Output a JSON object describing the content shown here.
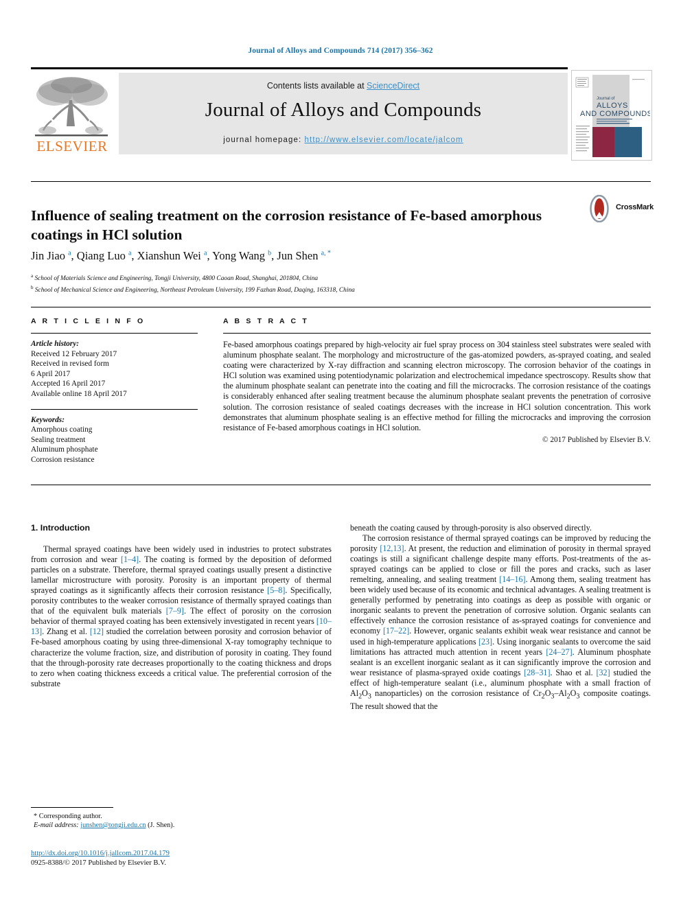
{
  "running_head": "Journal of Alloys and Compounds 714 (2017) 356–362",
  "masthead": {
    "contents_prefix": "Contents lists available at ",
    "sciencedirect": "ScienceDirect",
    "journal_title": "Journal of Alloys and Compounds",
    "homepage_prefix": "journal homepage: ",
    "homepage_url": "http://www.elsevier.com/locate/jalcom",
    "publisher": "ELSEVIER",
    "cover": {
      "line1": "Journal of",
      "line2": "ALLOYS",
      "line3": "AND COMPOUNDS"
    },
    "accent_link_color": "#3a8fc8",
    "elsevier_orange": "#E87722"
  },
  "crossmark": {
    "label": "CrossMark"
  },
  "article": {
    "title": "Influence of sealing treatment on the corrosion resistance of Fe-based amorphous coatings in HCl solution",
    "authors_html": "Jin Jiao <sup>a</sup>, Qiang Luo <sup>a</sup>, Xianshun Wei <sup>a</sup>, Yong Wang <sup>b</sup>, Jun Shen <sup>a, *</sup>",
    "affiliation_a": "School of Materials Science and Engineering, Tongji University, 4800 Caoan Road, Shanghai, 201804, China",
    "affiliation_b": "School of Mechanical Science and Engineering, Northeast Petroleum University, 199 Fazhan Road, Daqing, 163318, China"
  },
  "info": {
    "heading": "A R T I C L E   I N F O",
    "history_label": "Article history:",
    "history": [
      "Received 12 February 2017",
      "Received in revised form",
      "6 April 2017",
      "Accepted 16 April 2017",
      "Available online 18 April 2017"
    ],
    "keywords_label": "Keywords:",
    "keywords": [
      "Amorphous coating",
      "Sealing treatment",
      "Aluminum phosphate",
      "Corrosion resistance"
    ]
  },
  "abstract": {
    "heading": "A B S T R A C T",
    "text": "Fe-based amorphous coatings prepared by high-velocity air fuel spray process on 304 stainless steel substrates were sealed with aluminum phosphate sealant. The morphology and microstructure of the gas-atomized powders, as-sprayed coating, and sealed coating were characterized by X-ray diffraction and scanning electron microscopy. The corrosion behavior of the coatings in HCl solution was examined using potentiodynamic polarization and electrochemical impedance spectroscopy. Results show that the aluminum phosphate sealant can penetrate into the coating and fill the microcracks. The corrosion resistance of the coatings is considerably enhanced after sealing treatment because the aluminum phosphate sealant prevents the penetration of corrosive solution. The corrosion resistance of sealed coatings decreases with the increase in HCl solution concentration. This work demonstrates that aluminum phosphate sealing is an effective method for filling the microcracks and improving the corrosion resistance of Fe-based amorphous coatings in HCl solution.",
    "copyright": "© 2017 Published by Elsevier B.V."
  },
  "body": {
    "section_title": "1. Introduction",
    "left_paragraphs_html": [
      "Thermal sprayed coatings have been widely used in industries to protect substrates from corrosion and wear <span class=\"ref\">[1&#8211;4]</span>. The coating is formed by the deposition of deformed particles on a substrate. Therefore, thermal sprayed coatings usually present a distinctive lamellar microstructure with porosity. Porosity is an important property of thermal sprayed coatings as it significantly affects their corrosion resistance <span class=\"ref\">[5&#8211;8]</span>. Specifically, porosity contributes to the weaker corrosion resistance of thermally sprayed coatings than that of the equivalent bulk materials <span class=\"ref\">[7&#8211;9]</span>. The effect of porosity on the corrosion behavior of thermal sprayed coating has been extensively investigated in recent years <span class=\"ref\">[10&#8211;13]</span>. Zhang et al. <span class=\"ref\">[12]</span> studied the correlation between porosity and corrosion behavior of Fe-based amorphous coating by using three-dimensional X-ray tomography technique to characterize the volume fraction, size, and distribution of porosity in coating. They found that the through-porosity rate decreases proportionally to the coating thickness and drops to zero when coating thickness exceeds a critical value. The preferential corrosion of the substrate"
    ],
    "right_paragraphs_html": [
      "beneath the coating caused by through-porosity is also observed directly.",
      "The corrosion resistance of thermal sprayed coatings can be improved by reducing the porosity <span class=\"ref\">[12,13]</span>. At present, the reduction and elimination of porosity in thermal sprayed coatings is still a significant challenge despite many efforts. Post-treatments of the as-sprayed coatings can be applied to close or fill the pores and cracks, such as laser remelting, annealing, and sealing treatment <span class=\"ref\">[14&#8211;16]</span>. Among them, sealing treatment has been widely used because of its economic and technical advantages. A sealing treatment is generally performed by penetrating into coatings as deep as possible with organic or inorganic sealants to prevent the penetration of corrosive solution. Organic sealants can effectively enhance the corrosion resistance of as-sprayed coatings for convenience and economy <span class=\"ref\">[17&#8211;22]</span>. However, organic sealants exhibit weak wear resistance and cannot be used in high-temperature applications <span class=\"ref\">[23]</span>. Using inorganic sealants to overcome the said limitations has attracted much attention in recent years <span class=\"ref\">[24&#8211;27]</span>. Aluminum phosphate sealant is an excellent inorganic sealant as it can significantly improve the corrosion and wear resistance of plasma-sprayed oxide coatings <span class=\"ref\">[28&#8211;31]</span>. Shao et al. <span class=\"ref\">[32]</span> studied the effect of high-temperature sealant (i.e., aluminum phosphate with a small fraction of Al<sub>2</sub>O<sub>3</sub> nanoparticles) on the corrosion resistance of Cr<sub>2</sub>O<sub>3</sub>&#8211;Al<sub>2</sub>O<sub>3</sub> composite coatings. The result showed that the"
    ]
  },
  "footnote": {
    "corresponding": "* Corresponding author.",
    "email_label": "E-mail address:",
    "email": "junshen@tongji.edu.cn",
    "email_suffix": "(J. Shen)."
  },
  "footer": {
    "doi": "http://dx.doi.org/10.1016/j.jallcom.2017.04.179",
    "issn": "0925-8388/© 2017 Published by Elsevier B.V."
  }
}
